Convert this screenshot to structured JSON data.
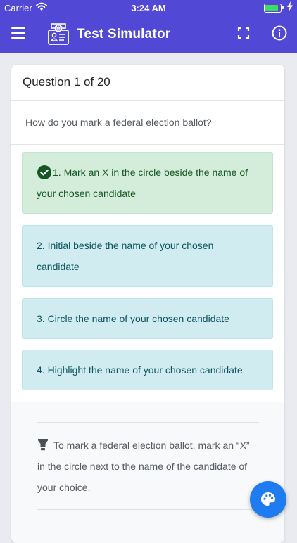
{
  "status_bar": {
    "carrier": "Carrier",
    "time": "3:24 AM",
    "battery_level": 0.95,
    "battery_color": "#3ddc60"
  },
  "app_bar": {
    "title": "Test Simulator",
    "background": "#5148d6",
    "icons": [
      "menu-icon",
      "id-card-logo-icon",
      "fullscreen-icon",
      "info-icon"
    ]
  },
  "quiz": {
    "header": "Question 1 of 20",
    "question": "How do you mark a federal election ballot?",
    "answers": [
      {
        "label": "1. Mark an X in the circle beside the name of your chosen candidate",
        "state": "correct",
        "icon": "check-circle-icon"
      },
      {
        "label": "2. Initial beside the name of your chosen candidate",
        "state": "neutral"
      },
      {
        "label": "3. Circle the name of your chosen candidate",
        "state": "neutral"
      },
      {
        "label": "4. Highlight the name of your chosen candidate",
        "state": "neutral"
      }
    ],
    "explanation": {
      "icon": "lightbulb-icon",
      "text": "To mark a federal election ballot, mark an “X” in the circle next to the name of the candidate of your choice."
    }
  },
  "fab": {
    "icon": "palette-icon",
    "color": "#1f7bf0"
  },
  "colors": {
    "correct_bg": "#d4edda",
    "correct_text": "#155724",
    "neutral_bg": "#d1ecf1",
    "neutral_text": "#0c5460"
  }
}
